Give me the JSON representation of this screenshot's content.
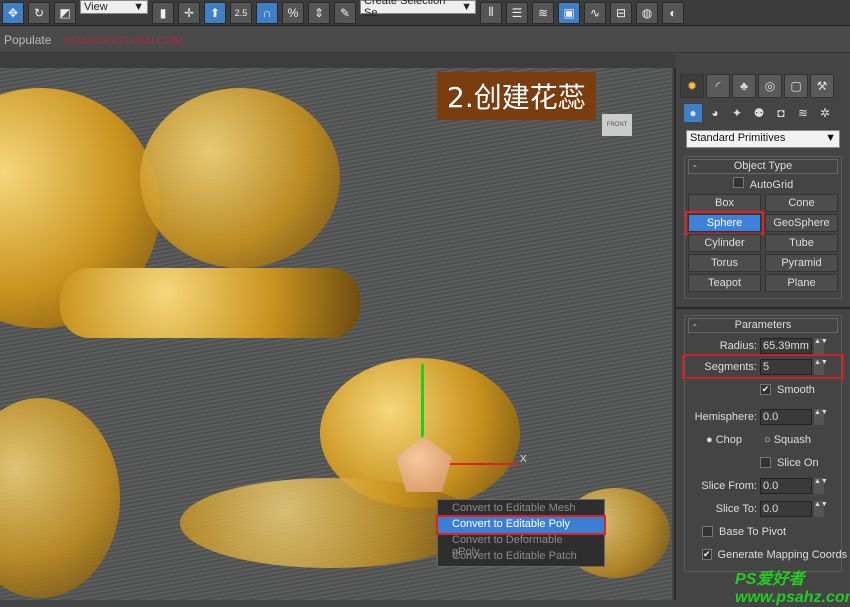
{
  "toolbar": {
    "view_select": "View",
    "snap_angle": "2.5",
    "selection_set": "Create Selection Se"
  },
  "ribbon": {
    "populate": "Populate",
    "watermark": "WWW.MISSYUAN.COM"
  },
  "viewport": {
    "title": "2.创建花蕊",
    "viewcube": "FRONT",
    "axis_x": "X"
  },
  "context_menu": {
    "items": [
      {
        "label": "Convert to Editable Mesh",
        "selected": false
      },
      {
        "label": "Convert to Editable Poly",
        "selected": true
      },
      {
        "label": "Convert to Deformable gPoly",
        "selected": false
      },
      {
        "label": "Convert to Editable Patch",
        "selected": false
      }
    ]
  },
  "panel": {
    "category": "Standard Primitives",
    "object_type": {
      "title": "Object Type",
      "autogrid": "AutoGrid",
      "buttons": [
        "Box",
        "Cone",
        "Sphere",
        "GeoSphere",
        "Cylinder",
        "Tube",
        "Torus",
        "Pyramid",
        "Teapot",
        "Plane"
      ],
      "selected": "Sphere"
    },
    "parameters": {
      "title": "Parameters",
      "radius_label": "Radius:",
      "radius": "65.39mm",
      "segments_label": "Segments:",
      "segments": "5",
      "smooth": "Smooth",
      "hemisphere_label": "Hemisphere:",
      "hemisphere": "0.0",
      "chop": "Chop",
      "squash": "Squash",
      "slice_on": "Slice On",
      "slice_from_label": "Slice From:",
      "slice_from": "0.0",
      "slice_to_label": "Slice To:",
      "slice_to": "0.0",
      "base_to_pivot": "Base To Pivot",
      "gen_mapping": "Generate Mapping Coords"
    }
  },
  "watermark2": "PS爱好者 www.psahz.com",
  "colors": {
    "accent": "#3d82d8",
    "highlight": "#d22222",
    "title_bg": "#7a3d10"
  }
}
